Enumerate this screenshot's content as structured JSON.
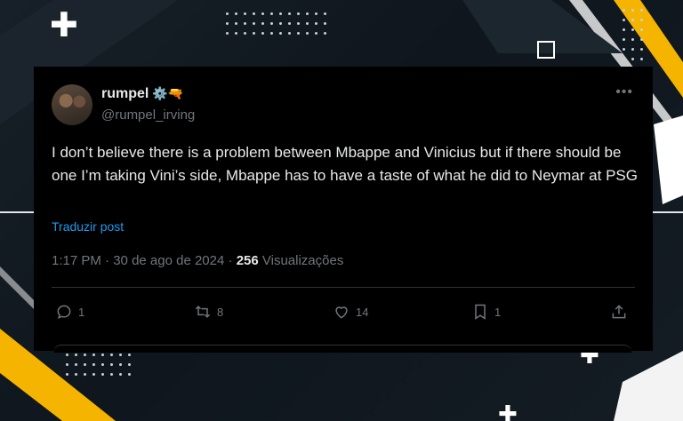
{
  "tweet": {
    "display_name": "rumpel",
    "name_emojis": "⚙️🔫",
    "handle": "@rumpel_irving",
    "more_icon": "more-dots-icon",
    "text": "I don’t believe there is a problem between Mbappe and Vinicius but if there should be one I’m taking Vini’s side, Mbappe has to have a taste of what he did to Neymar at PSG",
    "translate_label": "Traduzir post",
    "time": "1:17 PM",
    "date": "30 de ago de 2024",
    "views_count": "256",
    "views_label": "Visualizações",
    "replies": "1",
    "retweets": "8",
    "likes": "14",
    "bookmarks": "1"
  },
  "colors": {
    "card_bg": "#000000",
    "text": "#e7e9ea",
    "muted": "#71767b",
    "link": "#1d9bf0",
    "accent_yellow": "#f5b400"
  }
}
